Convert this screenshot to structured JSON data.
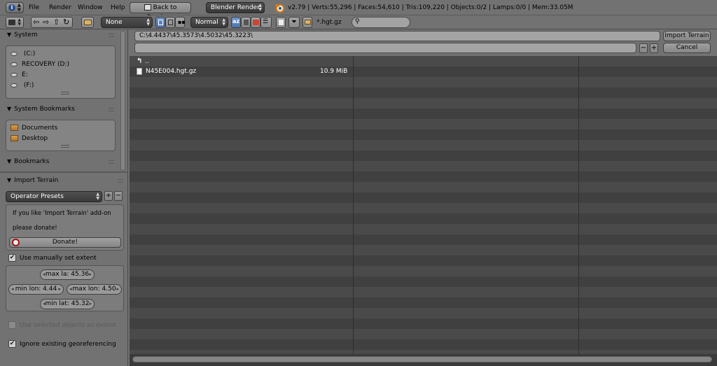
{
  "topbar": {
    "menus": [
      "File",
      "Render",
      "Window",
      "Help"
    ],
    "back_button": "Back to Previous",
    "render_engine": "Blender Render",
    "info": "v2.79 | Verts:55,296 | Faces:54,610 | Tris:109,220 | Objects:0/2 | Lamps:0/0 | Mem:33.05M"
  },
  "toolbar": {
    "recursion": "None",
    "thumb_size": "Normal",
    "filter_glob": "*.hgt.gz",
    "search_placeholder": ""
  },
  "sidebar": {
    "system": {
      "title": "System",
      "items": [
        " (C:)",
        "RECOVERY (D:)",
        "E:",
        " (F:)"
      ]
    },
    "system_bookmarks": {
      "title": "System Bookmarks",
      "items": [
        "Documents",
        "Desktop"
      ]
    },
    "bookmarks": {
      "title": "Bookmarks"
    },
    "import_terrain": {
      "title": "Import Terrain",
      "operator_presets": "Operator Presets",
      "donate_line1": "If you like 'Import Terrain' add-on",
      "donate_line2": "please donate!",
      "donate_button": "Donate!",
      "use_manual_extent": "Use manually set extent",
      "use_manual_extent_checked": true,
      "max_lat": "max la: 45.36",
      "min_lon": "min lon:  4.44",
      "max_lon": "max lon: 4.50",
      "min_lat": "min lat: 45.32",
      "use_selected_objects": "Use selected objects as extent",
      "use_selected_objects_checked": false,
      "ignore_georef": "Ignore existing georeferencing",
      "ignore_georef_checked": true
    }
  },
  "paths": {
    "directory": "C:\\4.4437\\45.3573\\4.5032\\45.3223\\",
    "filename": "",
    "import_button": "Import Terrain",
    "cancel_button": "Cancel"
  },
  "files": {
    "parent": "..",
    "rows": [
      {
        "name": "N45E004.hgt.gz",
        "size": "10.9 MiB"
      }
    ]
  },
  "colors": {
    "selected_blue": "#5a80b8",
    "row_light": "#4a4a4a",
    "row_dark": "#404040",
    "panel_bg": "#727272"
  }
}
